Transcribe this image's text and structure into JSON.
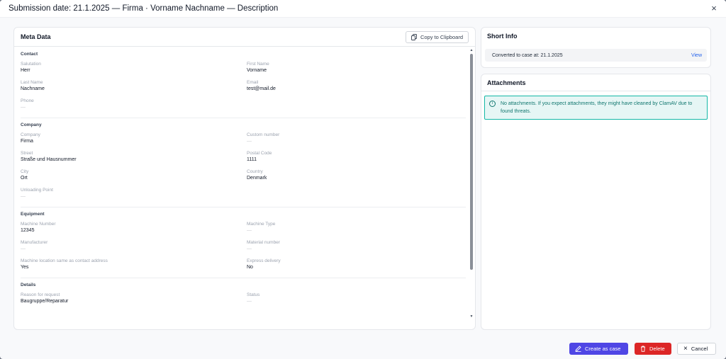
{
  "header": {
    "title": "Submission date: 21.1.2025 — Firma · Vorname Nachname — Description",
    "close_icon": "×"
  },
  "meta": {
    "title": "Meta Data",
    "copy_label": "Copy to Clipboard",
    "sections": {
      "contact": {
        "title": "Contact",
        "salutation_label": "Salutation",
        "salutation_value": "Herr",
        "first_name_label": "First Name",
        "first_name_value": "Vorname",
        "last_name_label": "Last Name",
        "last_name_value": "Nachname",
        "email_label": "Email",
        "email_value": "test@mail.de",
        "phone_label": "Phone",
        "phone_value": "—"
      },
      "company": {
        "title": "Company",
        "company_label": "Company",
        "company_value": "Firma",
        "custom_number_label": "Custom number",
        "custom_number_value": "—",
        "street_label": "Street",
        "street_value": "Straße und Hausnummer",
        "postal_code_label": "Postal Code",
        "postal_code_value": "1111",
        "city_label": "City",
        "city_value": "Ort",
        "country_label": "Country",
        "country_value": "Denmark",
        "unloading_point_label": "Unloading Point",
        "unloading_point_value": "—"
      },
      "equipment": {
        "title": "Equipment",
        "machine_number_label": "Machine Number",
        "machine_number_value": "12345",
        "machine_type_label": "Machine Type",
        "machine_type_value": "—",
        "manufacturer_label": "Manufacturer",
        "manufacturer_value": "—",
        "material_number_label": "Material number",
        "material_number_value": "—",
        "machine_location_label": "Machine location same as contact address",
        "machine_location_value": "Yes",
        "express_delivery_label": "Express delivery",
        "express_delivery_value": "No"
      },
      "details": {
        "title": "Details",
        "reason_label": "Reason for request",
        "reason_value": "Baugruppe/Reparatur",
        "status_label": "Status",
        "status_value": "—"
      }
    }
  },
  "short_info": {
    "title": "Short Info",
    "converted_text": "Converted to case at: 21.1.2025",
    "view_label": "View"
  },
  "attachments": {
    "title": "Attachments",
    "info_text": "No attachments. If you expect attachments, they might have cleaned by ClamAV due to found threats."
  },
  "footer": {
    "create_label": "Create as case",
    "delete_label": "Delete",
    "cancel_label": "Cancel"
  },
  "colors": {
    "primary": "#4f46e5",
    "danger": "#dc2626",
    "info_border": "#14b8a6",
    "link": "#2563eb"
  }
}
